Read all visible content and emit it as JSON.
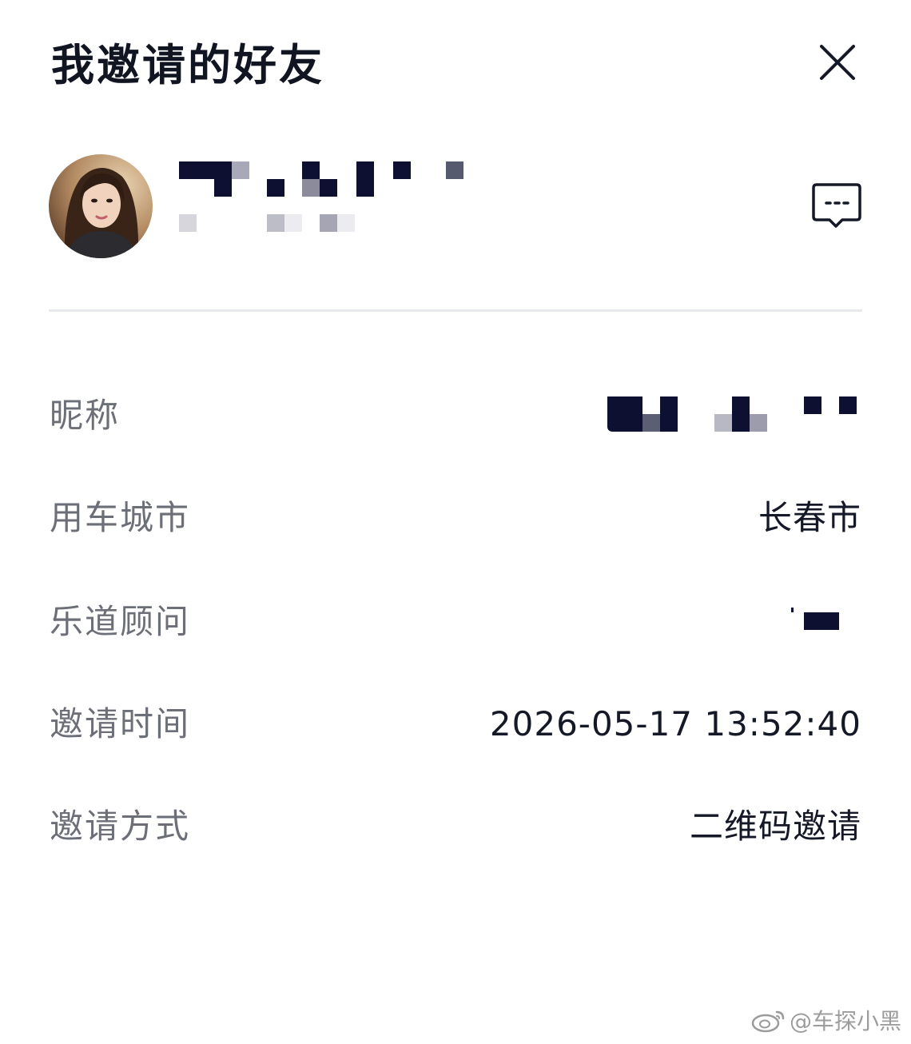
{
  "header": {
    "title": "我邀请的好友"
  },
  "icons": {
    "close": "close-icon",
    "message": "message-icon",
    "weibo": "weibo-logo-icon"
  },
  "details": {
    "nickname_label": "昵称",
    "city_label": "用车城市",
    "city_value": "长春市",
    "advisor_label": "乐道顾问",
    "invite_time_label": "邀请时间",
    "invite_time_value": "2026-05-17 13:52:40",
    "invite_method_label": "邀请方式",
    "invite_method_value": "二维码邀请"
  },
  "watermark": {
    "text": "@车探小黑"
  },
  "colors": {
    "text_primary": "#151826",
    "text_secondary": "#6c6f78",
    "divider": "#e8e9ec",
    "mosaic_dark": "#0d1030"
  }
}
